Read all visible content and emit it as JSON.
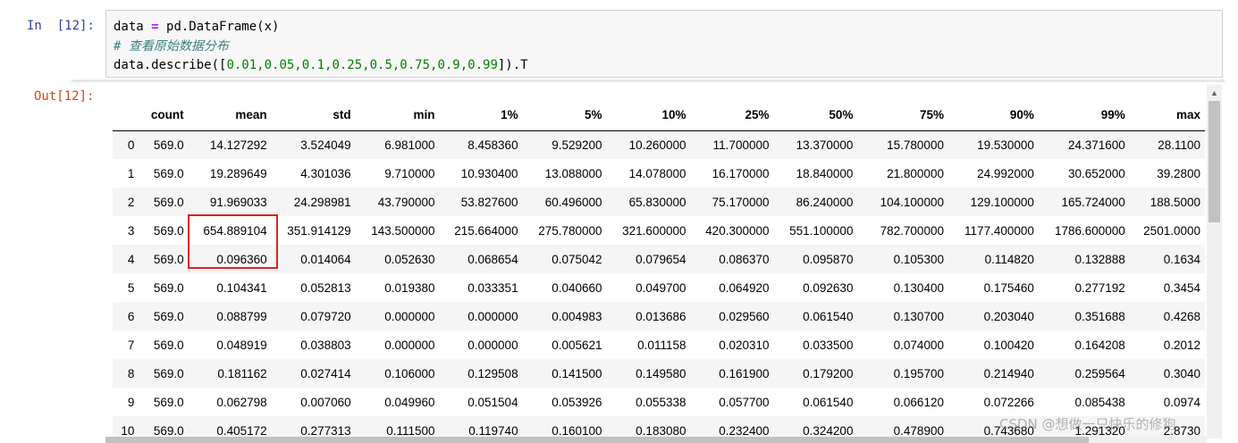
{
  "input_prompt": "In  [12]:",
  "output_prompt": "Out[12]:",
  "code": {
    "line1": {
      "a": "data ",
      "op": "=",
      "b": " pd.DataFrame(x)"
    },
    "line2": "# 查看原始数据分布",
    "line3": {
      "a": "data.describe([",
      "nums": "0.01,0.05,0.1,0.25,0.5,0.75,0.9,0.99",
      "b": "]).T"
    }
  },
  "table": {
    "columns": [
      "",
      "count",
      "mean",
      "std",
      "min",
      "1%",
      "5%",
      "10%",
      "25%",
      "50%",
      "75%",
      "90%",
      "99%",
      "max"
    ],
    "rows": [
      [
        "0",
        "569.0",
        "14.127292",
        "3.524049",
        "6.981000",
        "8.458360",
        "9.529200",
        "10.260000",
        "11.700000",
        "13.370000",
        "15.780000",
        "19.530000",
        "24.371600",
        "28.1100"
      ],
      [
        "1",
        "569.0",
        "19.289649",
        "4.301036",
        "9.710000",
        "10.930400",
        "13.088000",
        "14.078000",
        "16.170000",
        "18.840000",
        "21.800000",
        "24.992000",
        "30.652000",
        "39.2800"
      ],
      [
        "2",
        "569.0",
        "91.969033",
        "24.298981",
        "43.790000",
        "53.827600",
        "60.496000",
        "65.830000",
        "75.170000",
        "86.240000",
        "104.100000",
        "129.100000",
        "165.724000",
        "188.5000"
      ],
      [
        "3",
        "569.0",
        "654.889104",
        "351.914129",
        "143.500000",
        "215.664000",
        "275.780000",
        "321.600000",
        "420.300000",
        "551.100000",
        "782.700000",
        "1177.400000",
        "1786.600000",
        "2501.0000"
      ],
      [
        "4",
        "569.0",
        "0.096360",
        "0.014064",
        "0.052630",
        "0.068654",
        "0.075042",
        "0.079654",
        "0.086370",
        "0.095870",
        "0.105300",
        "0.114820",
        "0.132888",
        "0.1634"
      ],
      [
        "5",
        "569.0",
        "0.104341",
        "0.052813",
        "0.019380",
        "0.033351",
        "0.040660",
        "0.049700",
        "0.064920",
        "0.092630",
        "0.130400",
        "0.175460",
        "0.277192",
        "0.3454"
      ],
      [
        "6",
        "569.0",
        "0.088799",
        "0.079720",
        "0.000000",
        "0.000000",
        "0.004983",
        "0.013686",
        "0.029560",
        "0.061540",
        "0.130700",
        "0.203040",
        "0.351688",
        "0.4268"
      ],
      [
        "7",
        "569.0",
        "0.048919",
        "0.038803",
        "0.000000",
        "0.000000",
        "0.005621",
        "0.011158",
        "0.020310",
        "0.033500",
        "0.074000",
        "0.100420",
        "0.164208",
        "0.2012"
      ],
      [
        "8",
        "569.0",
        "0.181162",
        "0.027414",
        "0.106000",
        "0.129508",
        "0.141500",
        "0.149580",
        "0.161900",
        "0.179200",
        "0.195700",
        "0.214940",
        "0.259564",
        "0.3040"
      ],
      [
        "9",
        "569.0",
        "0.062798",
        "0.007060",
        "0.049960",
        "0.051504",
        "0.053926",
        "0.055338",
        "0.057700",
        "0.061540",
        "0.066120",
        "0.072266",
        "0.085438",
        "0.0974"
      ],
      [
        "10",
        "569.0",
        "0.405172",
        "0.277313",
        "0.111500",
        "0.119740",
        "0.160100",
        "0.183080",
        "0.232400",
        "0.324200",
        "0.478900",
        "0.743680",
        "1.291320",
        "2.8730"
      ]
    ]
  },
  "watermark": "CSDN @想做一只快乐的修狗",
  "colors": {
    "input_prompt": "#303f9f",
    "output_prompt": "#d84315",
    "highlight": "#e02020",
    "code_comment": "#408080"
  }
}
